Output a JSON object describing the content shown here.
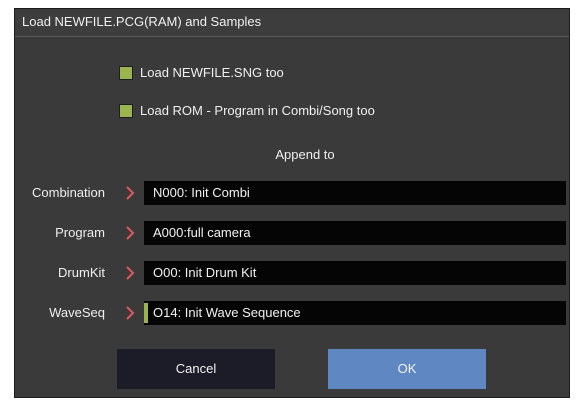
{
  "dialog": {
    "title": "Load NEWFILE.PCG(RAM) and Samples",
    "options": [
      {
        "label": "Load NEWFILE.SNG too",
        "checked": true
      },
      {
        "label": "Load ROM - Program in Combi/Song too",
        "checked": true
      }
    ],
    "append_label": "Append to",
    "fields": [
      {
        "label": "Combination",
        "value": "N000: Init Combi"
      },
      {
        "label": "Program",
        "value": "A000:full camera"
      },
      {
        "label": "DrumKit",
        "value": "O00: Init Drum Kit"
      },
      {
        "label": "WaveSeq",
        "value": "O14: Init Wave Sequence"
      }
    ],
    "buttons": {
      "cancel": "Cancel",
      "ok": "OK"
    }
  },
  "colors": {
    "checkbox": "#9ab54e",
    "chevron": "#e0565c",
    "ok_button": "#5f88c2",
    "cancel_button": "#1c1c28",
    "dialog_bg": "#3a3a3a"
  },
  "icons": [
    "chevron-right-icon",
    "checkbox-checked-icon"
  ]
}
